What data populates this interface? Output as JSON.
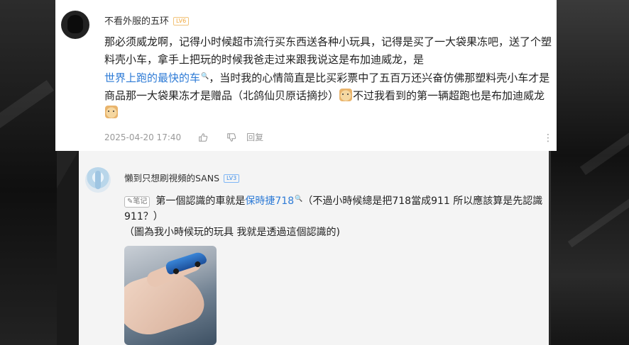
{
  "comment1": {
    "username": "不看外服的五环",
    "level": "LV6",
    "text_part1": "那必须威龙啊，记得小时候超市流行买东西送各种小玩具，记得是买了一大袋果冻吧，送了个塑料壳小车，拿手上把玩的时候我爸走过来跟我说这是布加迪威龙，是",
    "link_text": "世界上跑的最快的车",
    "text_part2": "，当时我的心情简直是比买彩票中了五百万还兴奋仿佛那塑料壳小车才是商品那一大袋果冻才是赠品（北鸽仙贝原话摘抄）",
    "text_part3": "不过我看到的第一辆超跑也是布加迪威龙",
    "timestamp": "2025-04-20 17:40",
    "reply_label": "回复"
  },
  "comment2": {
    "username": "懶到只想刷視頻的SANS",
    "level": "LV3",
    "note_tag": "笔记",
    "text_part1": "第一個認識的車就是",
    "link_text": "保時捷718",
    "text_part2": "（不過小時候總是把718當成911 所以應該算是先認識911？）",
    "text_line2": "（圖為我小時候玩的玩具 我就是透過這個認識的)"
  },
  "colors": {
    "link": "#2e7bd6",
    "level_badge_6": "#f1a83c",
    "level_badge_3": "#3c8de8",
    "meta_text": "#999999"
  },
  "icons": {
    "like": "thumb-up-icon",
    "dislike": "thumb-down-icon",
    "search_hint": "search-icon",
    "more": "more-dots-icon",
    "emoji": "doge-emoji-icon"
  }
}
